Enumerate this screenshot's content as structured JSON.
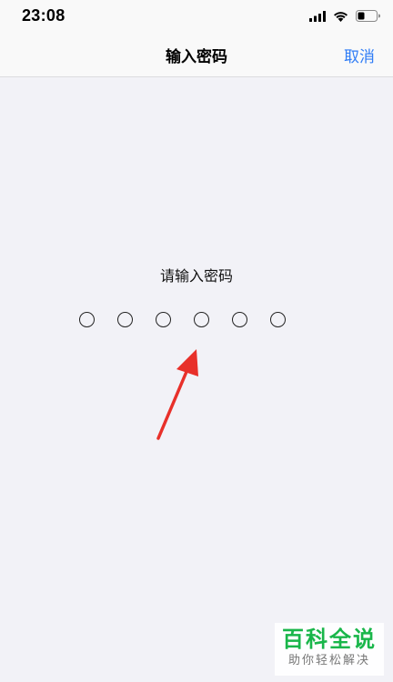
{
  "status_bar": {
    "time": "23:08",
    "icons": [
      "cellular-signal-icon",
      "wifi-icon",
      "battery-icon"
    ]
  },
  "nav": {
    "title": "输入密码",
    "cancel_label": "取消",
    "accent_color": "#2f7cf6"
  },
  "passcode": {
    "prompt": "请输入密码",
    "digit_count": 6,
    "entered_count": 0
  },
  "annotation": {
    "arrow_color": "#e8302a"
  },
  "watermark": {
    "title": "百科全说",
    "subtitle": "助你轻松解决"
  }
}
